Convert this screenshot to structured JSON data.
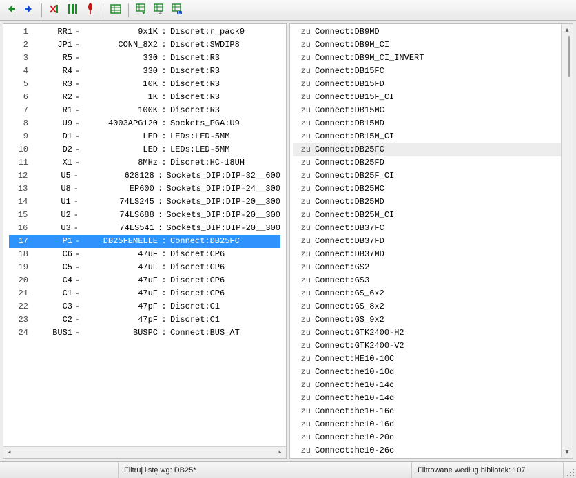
{
  "toolbar": {
    "back": "Back",
    "forward": "Forward",
    "delete": "Delete",
    "auto": "Auto",
    "pdf": "PDF",
    "table": "Table",
    "selectNext": "Next",
    "selectNextNum": "Next#",
    "selectNextL": "NextL"
  },
  "left": {
    "rows": [
      {
        "n": 1,
        "ref": "RR1",
        "dash": "-",
        "val": "9x1K",
        "fp": "Discret:r_pack9"
      },
      {
        "n": 2,
        "ref": "JP1",
        "dash": "-",
        "val": "CONN_8X2",
        "fp": "Discret:SWDIP8"
      },
      {
        "n": 3,
        "ref": "R5",
        "dash": "-",
        "val": "330",
        "fp": "Discret:R3"
      },
      {
        "n": 4,
        "ref": "R4",
        "dash": "-",
        "val": "330",
        "fp": "Discret:R3"
      },
      {
        "n": 5,
        "ref": "R3",
        "dash": "-",
        "val": "10K",
        "fp": "Discret:R3"
      },
      {
        "n": 6,
        "ref": "R2",
        "dash": "-",
        "val": "1K",
        "fp": "Discret:R3"
      },
      {
        "n": 7,
        "ref": "R1",
        "dash": "-",
        "val": "100K",
        "fp": "Discret:R3"
      },
      {
        "n": 8,
        "ref": "U9",
        "dash": "-",
        "val": "4003APG120",
        "fp": "Sockets_PGA:U9"
      },
      {
        "n": 9,
        "ref": "D1",
        "dash": "-",
        "val": "LED",
        "fp": "LEDs:LED-5MM"
      },
      {
        "n": 10,
        "ref": "D2",
        "dash": "-",
        "val": "LED",
        "fp": "LEDs:LED-5MM"
      },
      {
        "n": 11,
        "ref": "X1",
        "dash": "-",
        "val": "8MHz",
        "fp": "Discret:HC-18UH"
      },
      {
        "n": 12,
        "ref": "U5",
        "dash": "-",
        "val": "628128",
        "fp": "Sockets_DIP:DIP-32__600"
      },
      {
        "n": 13,
        "ref": "U8",
        "dash": "-",
        "val": "EP600",
        "fp": "Sockets_DIP:DIP-24__300"
      },
      {
        "n": 14,
        "ref": "U1",
        "dash": "-",
        "val": "74LS245",
        "fp": "Sockets_DIP:DIP-20__300"
      },
      {
        "n": 15,
        "ref": "U2",
        "dash": "-",
        "val": "74LS688",
        "fp": "Sockets_DIP:DIP-20__300"
      },
      {
        "n": 16,
        "ref": "U3",
        "dash": "-",
        "val": "74LS541",
        "fp": "Sockets_DIP:DIP-20__300"
      },
      {
        "n": 17,
        "ref": "P1",
        "dash": "-",
        "val": "DB25FEMELLE",
        "fp": "Connect:DB25FC",
        "selected": true
      },
      {
        "n": 18,
        "ref": "C6",
        "dash": "-",
        "val": "47uF",
        "fp": "Discret:CP6"
      },
      {
        "n": 19,
        "ref": "C5",
        "dash": "-",
        "val": "47uF",
        "fp": "Discret:CP6"
      },
      {
        "n": 20,
        "ref": "C4",
        "dash": "-",
        "val": "47uF",
        "fp": "Discret:CP6"
      },
      {
        "n": 21,
        "ref": "C1",
        "dash": "-",
        "val": "47uF",
        "fp": "Discret:CP6"
      },
      {
        "n": 22,
        "ref": "C3",
        "dash": "-",
        "val": "47pF",
        "fp": "Discret:C1"
      },
      {
        "n": 23,
        "ref": "C2",
        "dash": "-",
        "val": "47pF",
        "fp": "Discret:C1"
      },
      {
        "n": 24,
        "ref": "BUS1",
        "dash": "-",
        "val": "BUSPC",
        "fp": "Connect:BUS_AT"
      }
    ]
  },
  "right": {
    "prefix": "zu",
    "items": [
      {
        "name": "Connect:DB9MD"
      },
      {
        "name": "Connect:DB9M_CI"
      },
      {
        "name": "Connect:DB9M_CI_INVERT"
      },
      {
        "name": "Connect:DB15FC"
      },
      {
        "name": "Connect:DB15FD"
      },
      {
        "name": "Connect:DB15F_CI"
      },
      {
        "name": "Connect:DB15MC"
      },
      {
        "name": "Connect:DB15MD"
      },
      {
        "name": "Connect:DB15M_CI"
      },
      {
        "name": "Connect:DB25FC",
        "highlight": true
      },
      {
        "name": "Connect:DB25FD"
      },
      {
        "name": "Connect:DB25F_CI"
      },
      {
        "name": "Connect:DB25MC"
      },
      {
        "name": "Connect:DB25MD"
      },
      {
        "name": "Connect:DB25M_CI"
      },
      {
        "name": "Connect:DB37FC"
      },
      {
        "name": "Connect:DB37FD"
      },
      {
        "name": "Connect:DB37MD"
      },
      {
        "name": "Connect:GS2"
      },
      {
        "name": "Connect:GS3"
      },
      {
        "name": "Connect:GS_6x2"
      },
      {
        "name": "Connect:GS_8x2"
      },
      {
        "name": "Connect:GS_9x2"
      },
      {
        "name": "Connect:GTK2400-H2"
      },
      {
        "name": "Connect:GTK2400-V2"
      },
      {
        "name": "Connect:HE10-10C"
      },
      {
        "name": "Connect:he10-10d"
      },
      {
        "name": "Connect:he10-14c"
      },
      {
        "name": "Connect:he10-14d"
      },
      {
        "name": "Connect:he10-16c"
      },
      {
        "name": "Connect:he10-16d"
      },
      {
        "name": "Connect:he10-20c"
      },
      {
        "name": "Connect:he10-26c"
      }
    ]
  },
  "status": {
    "filter_label": "Filtruj listę wg: DB25*",
    "lib_count_label": "Filtrowane według bibliotek: 107"
  }
}
